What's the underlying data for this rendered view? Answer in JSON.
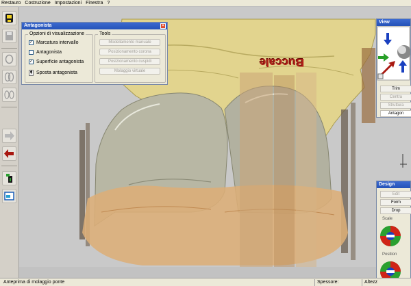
{
  "menu": [
    "Restauro",
    "Costruzione",
    "Impostazioni",
    "Finestra",
    "?"
  ],
  "antagonista_panel": {
    "title": "Antagonista",
    "options_group": "Opzioni di visualizzazione",
    "tools_group": "Tools",
    "options": [
      {
        "label": "Marcatura intervallo",
        "checked": true
      },
      {
        "label": "Antagonista",
        "checked": false
      },
      {
        "label": "Superficie antagonista",
        "checked": true
      }
    ],
    "sposta_label": "Sposta antagonista",
    "tools": [
      "Modellamento manuale",
      "Posizionamento corona",
      "Posizionamento cuspidi",
      "Molaggio virtuale"
    ]
  },
  "view_panel": {
    "title": "View",
    "buttons": [
      "Trim",
      "Centra",
      "Struttura",
      "Antagon"
    ]
  },
  "design_panel": {
    "title": "Design",
    "buttons": [
      "Edit",
      "Form",
      "Drop"
    ],
    "scale_label": "Scale",
    "position_label": "Position"
  },
  "viewport": {
    "label_text": "Buccale"
  },
  "status": {
    "left": "Anteprima di molaggio ponte",
    "thickness_label": "Spessore:",
    "height_label": "Altezz"
  },
  "colors": {
    "tooth": "#c8c4a6",
    "bone": "#e4d690",
    "gum": "#dcb07a",
    "titlebar": "#2452b8"
  }
}
